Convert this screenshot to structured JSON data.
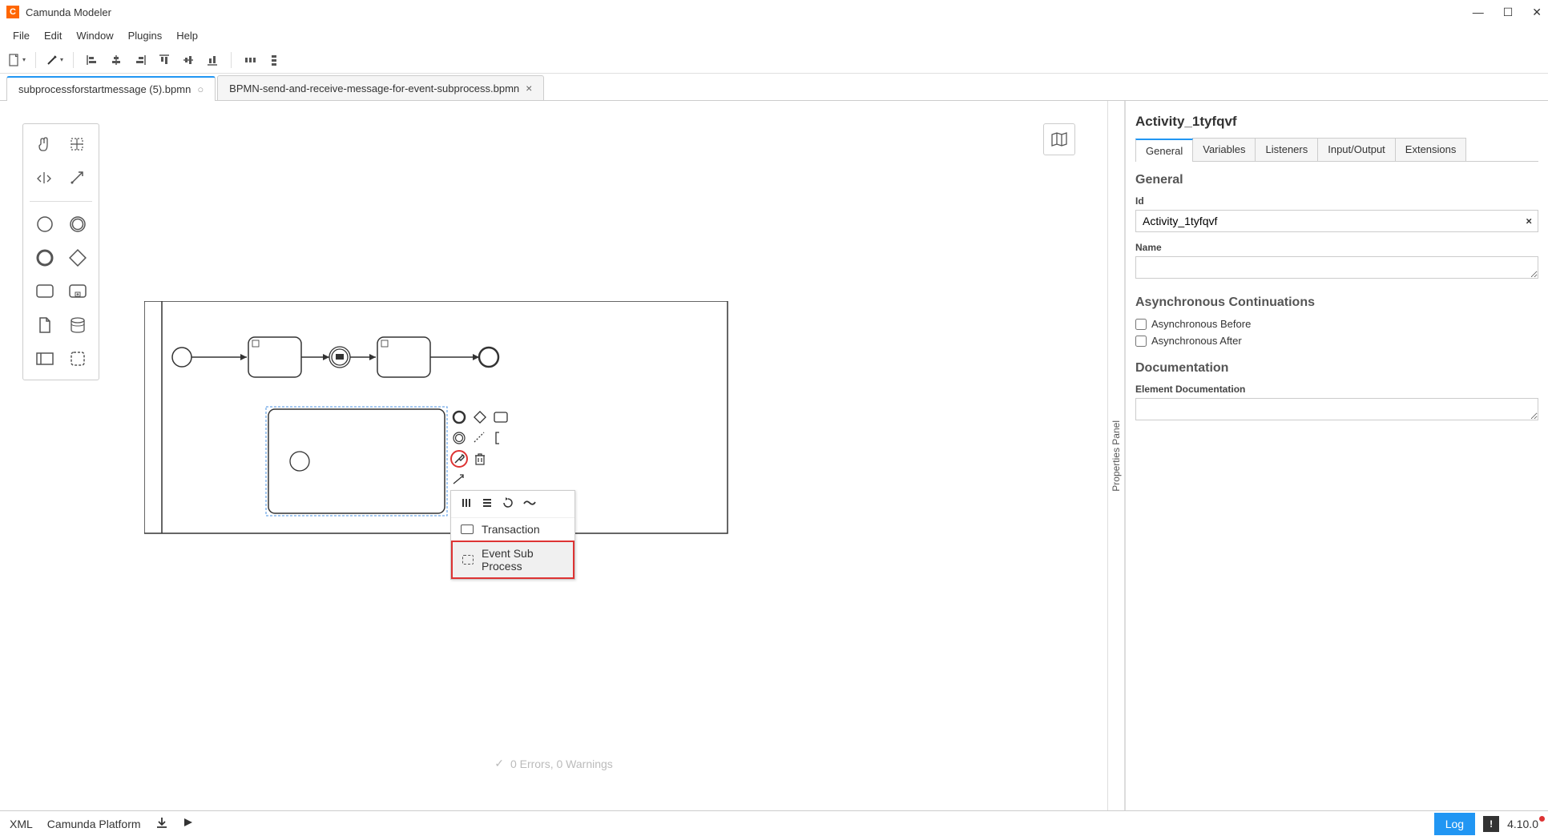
{
  "app": {
    "title": "Camunda Modeler"
  },
  "menu": {
    "items": [
      "File",
      "Edit",
      "Window",
      "Plugins",
      "Help"
    ]
  },
  "tabs": [
    {
      "label": "subprocessforstartmessage (5).bpmn",
      "active": true,
      "dirty": true
    },
    {
      "label": "BPMN-send-and-receive-message-for-event-subprocess.bpmn",
      "active": false,
      "closable": true
    }
  ],
  "popup": {
    "items": [
      {
        "label": "Transaction",
        "highlight": false
      },
      {
        "label": "Event Sub Process",
        "highlight": true
      }
    ]
  },
  "properties": {
    "panel_label": "Properties Panel",
    "title": "Activity_1tyfqvf",
    "tabs": [
      "General",
      "Variables",
      "Listeners",
      "Input/Output",
      "Extensions"
    ],
    "active_tab": "General",
    "sections": {
      "general": {
        "heading": "General",
        "id_label": "Id",
        "id_value": "Activity_1tyfqvf",
        "name_label": "Name",
        "name_value": ""
      },
      "async": {
        "heading": "Asynchronous Continuations",
        "before_label": "Asynchronous Before",
        "before_checked": false,
        "after_label": "Asynchronous After",
        "after_checked": false
      },
      "doc": {
        "heading": "Documentation",
        "element_doc_label": "Element Documentation",
        "element_doc_value": ""
      }
    }
  },
  "validation": {
    "text": "0 Errors, 0 Warnings"
  },
  "statusbar": {
    "left": [
      "XML",
      "Camunda Platform"
    ],
    "log_label": "Log",
    "version": "4.10.0"
  }
}
